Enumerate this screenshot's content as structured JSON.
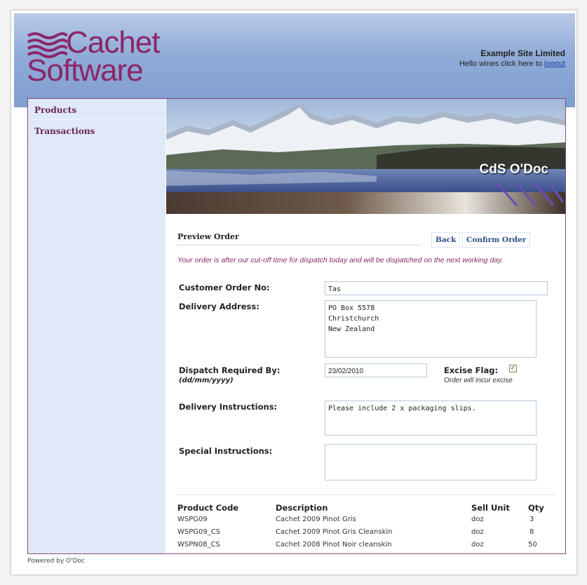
{
  "header": {
    "logo_line1": "Cachet",
    "logo_line2": "Software",
    "site_name": "Example Site Limited",
    "greeting": "Hello wines click here to",
    "logout_label": "logout"
  },
  "sidebar": {
    "items": [
      {
        "label": "Products"
      },
      {
        "label": "Transactions"
      }
    ]
  },
  "banner": {
    "title": "CdS O'Doc"
  },
  "main": {
    "title": "Preview Order",
    "back_label": "Back",
    "confirm_label": "Confirm Order",
    "notice": "Your order is after our cut-off time for dispatch today and will be dispatched on the next working day."
  },
  "form": {
    "customer_order_label": "Customer Order No:",
    "customer_order_value": "Tas",
    "delivery_address_label": "Delivery Address:",
    "delivery_address_value": "PO Box 5578\nChristchurch\nNew Zealand",
    "dispatch_label": "Dispatch Required By:",
    "dispatch_hint": "(dd/mm/yyyy)",
    "dispatch_value": "23/02/2010",
    "excise_label": "Excise Flag:",
    "excise_checked": true,
    "excise_hint": "Order will incur excise",
    "delivery_instructions_label": "Delivery Instructions:",
    "delivery_instructions_value": "Please include 2 x packaging slips.",
    "special_instructions_label": "Special Instructions:",
    "special_instructions_value": ""
  },
  "table": {
    "headers": {
      "code": "Product Code",
      "description": "Description",
      "unit": "Sell Unit",
      "qty": "Qty"
    },
    "rows": [
      {
        "code": "WSPG09",
        "description": "Cachet 2009 Pinot Gris",
        "unit": "doz",
        "qty": "3"
      },
      {
        "code": "WSPG09_CS",
        "description": "Cachet 2009 Pinot Gris Cleanskin",
        "unit": "doz",
        "qty": "8"
      },
      {
        "code": "WSPN08_CS",
        "description": "Cachet 2008 Pinot Noir cleanskin",
        "unit": "doz",
        "qty": "50"
      }
    ]
  },
  "footer": {
    "text": "Powered by O'Doc"
  },
  "colors": {
    "brand": "#8a2768",
    "sidebar_bg": "#dfe9f8",
    "header_bg": "#90abd8",
    "link": "#1a3fa6"
  }
}
